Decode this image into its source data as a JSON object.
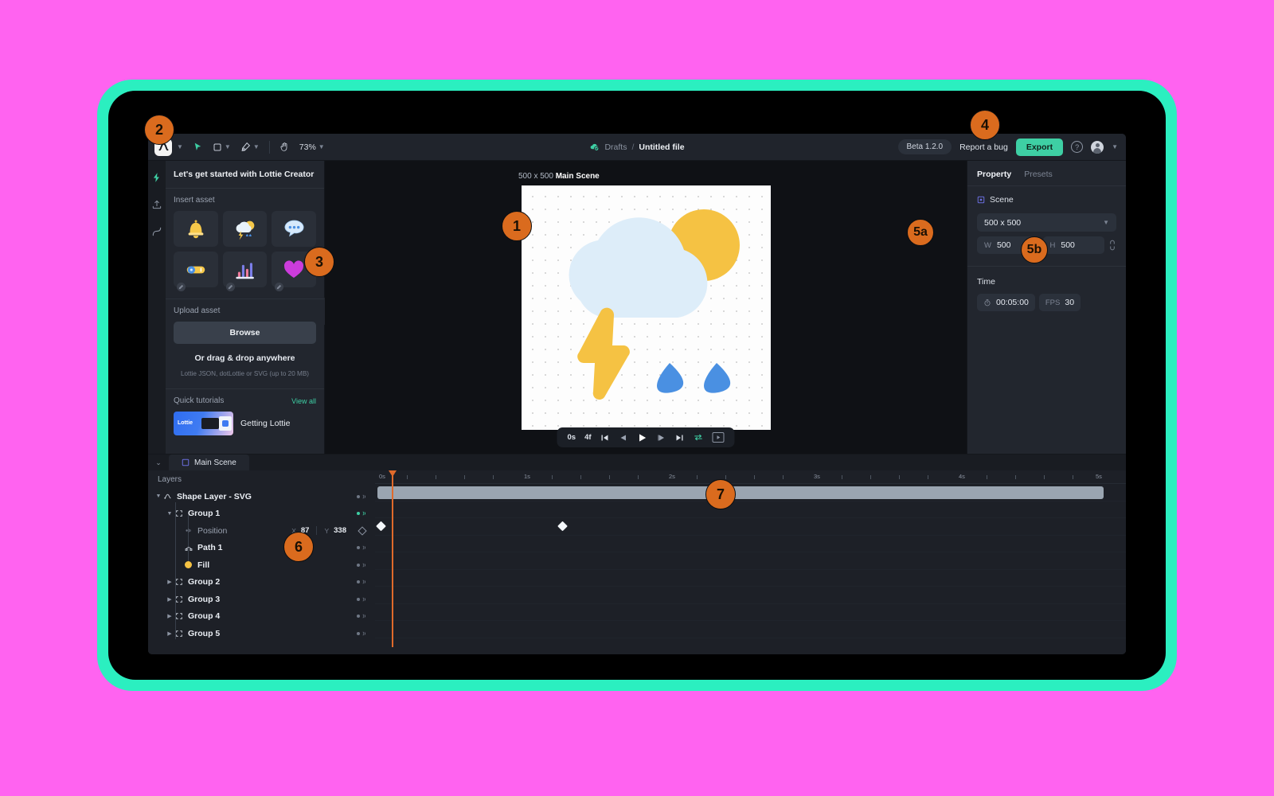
{
  "app": {
    "topbar": {
      "logo": "lottie-logo-icon",
      "tools": [
        {
          "name": "select-tool",
          "icon": "cursor-icon",
          "has_chevron": true
        },
        {
          "name": "shape-tool",
          "icon": "rectangle-icon",
          "has_chevron": true
        },
        {
          "name": "pen-tool",
          "icon": "pen-icon",
          "has_chevron": true
        },
        {
          "name": "hand-tool",
          "icon": "hand-icon",
          "has_chevron": false
        }
      ],
      "zoom": "73%",
      "breadcrumb": {
        "folder": "Drafts",
        "separator": "/",
        "file": "Untitled file"
      },
      "beta_pill": "Beta 1.2.0",
      "report_bug": "Report a bug",
      "export": "Export",
      "help": "?"
    },
    "rail": [
      {
        "name": "assets-rail-icon",
        "label": "lightning-icon",
        "active": true
      },
      {
        "name": "upload-rail-icon",
        "label": "upload-icon",
        "active": false
      },
      {
        "name": "curve-rail-icon",
        "label": "curve-icon",
        "active": false
      }
    ],
    "left_panel": {
      "title": "Let's get started with Lottie Creator",
      "insert_label": "Insert asset",
      "assets": [
        {
          "name": "asset-bell",
          "icon": "bell-icon"
        },
        {
          "name": "asset-weather",
          "icon": "weather-icon"
        },
        {
          "name": "asset-chat",
          "icon": "speech-bubble-icon"
        },
        {
          "name": "asset-toggle",
          "icon": "toggle-icon"
        },
        {
          "name": "asset-chart",
          "icon": "bar-chart-icon"
        },
        {
          "name": "asset-heart",
          "icon": "heart-icon"
        }
      ],
      "upload_label": "Upload asset",
      "browse": "Browse",
      "drag_text": "Or drag & drop anywhere",
      "formats": "Lottie JSON, dotLottie or SVG (up to 20 MB)",
      "tutorials_label": "Quick tutorials",
      "view_all": "View all",
      "tutorial_items": [
        {
          "title": "Getting Lottie",
          "thumb_text": "Lottie"
        }
      ]
    },
    "canvas": {
      "scene_size": "500 x 500",
      "scene_name": "Main Scene",
      "illustration": "weather-cloud-sun-lightning-rain",
      "colors": {
        "sun": "#F5C243",
        "cloud": "#DDEDF9",
        "bolt": "#F5C243",
        "drop": "#4A90E2",
        "stage_bg": "#FDFDFD"
      },
      "playback": {
        "time": "0s",
        "frame": "4f",
        "buttons": [
          {
            "name": "go-to-start-button",
            "icon": "skip-back-icon"
          },
          {
            "name": "step-back-button",
            "icon": "step-back-icon"
          },
          {
            "name": "play-button",
            "icon": "play-icon"
          },
          {
            "name": "step-forward-button",
            "icon": "step-forward-icon"
          },
          {
            "name": "go-to-end-button",
            "icon": "skip-forward-icon"
          },
          {
            "name": "loop-button",
            "icon": "loop-icon"
          },
          {
            "name": "fit-frame-button",
            "icon": "frame-box-icon"
          }
        ]
      }
    },
    "right_panel": {
      "tabs": [
        {
          "label": "Property",
          "active": true
        },
        {
          "label": "Presets",
          "active": false
        }
      ],
      "scene_label": "Scene",
      "size_preset": "500 x 500",
      "width": {
        "key": "W",
        "value": "500"
      },
      "height": {
        "key": "H",
        "value": "500"
      },
      "time_label": "Time",
      "duration": "00:05:00",
      "fps_key": "FPS",
      "fps_value": "30"
    },
    "timeline": {
      "tab": "Main Scene",
      "layers_header": "Layers",
      "rows": [
        {
          "name": "Shape Layer - SVG",
          "indent": 0,
          "icon": "shape-layer-icon",
          "caret": "down",
          "visible": true,
          "active": false
        },
        {
          "name": "Group 1",
          "indent": 1,
          "icon": "group-icon",
          "caret": "down",
          "visible": true,
          "active": true
        },
        {
          "name": "Position",
          "indent": 2,
          "icon": "keyframe-toggle-icon",
          "caret": "none",
          "visible": false,
          "active": false,
          "is_property": true,
          "x_key": "X",
          "x_value": "87",
          "y_key": "Y",
          "y_value": "338"
        },
        {
          "name": "Path 1",
          "indent": 2,
          "icon": "path-icon",
          "caret": "none",
          "visible": true,
          "active": false
        },
        {
          "name": "Fill",
          "indent": 2,
          "icon": "fill-swatch-icon",
          "caret": "none",
          "visible": true,
          "active": false,
          "swatch": "#F5C243"
        },
        {
          "name": "Group 2",
          "indent": 1,
          "icon": "group-icon",
          "caret": "right",
          "visible": true,
          "active": false
        },
        {
          "name": "Group 3",
          "indent": 1,
          "icon": "group-icon",
          "caret": "right",
          "visible": true,
          "active": false
        },
        {
          "name": "Group 4",
          "indent": 1,
          "icon": "group-icon",
          "caret": "right",
          "visible": true,
          "active": false
        },
        {
          "name": "Group 5",
          "indent": 1,
          "icon": "group-icon",
          "caret": "right",
          "visible": true,
          "active": false
        }
      ],
      "ruler_labels": [
        "0s",
        "1s",
        "2s",
        "3s",
        "4s",
        "5s"
      ],
      "playhead_time": "0s",
      "keyframes_seconds": [
        0.0,
        1.17
      ]
    },
    "callouts": [
      {
        "id": "1",
        "label": "canvas-stage-callout"
      },
      {
        "id": "2",
        "label": "logo-callout"
      },
      {
        "id": "3",
        "label": "assets-callout"
      },
      {
        "id": "4",
        "label": "export-callout"
      },
      {
        "id": "5a",
        "label": "scene-size-callout"
      },
      {
        "id": "5b",
        "label": "property-tabs-callout"
      },
      {
        "id": "6",
        "label": "layers-callout"
      },
      {
        "id": "7",
        "label": "playback-callout"
      }
    ]
  }
}
